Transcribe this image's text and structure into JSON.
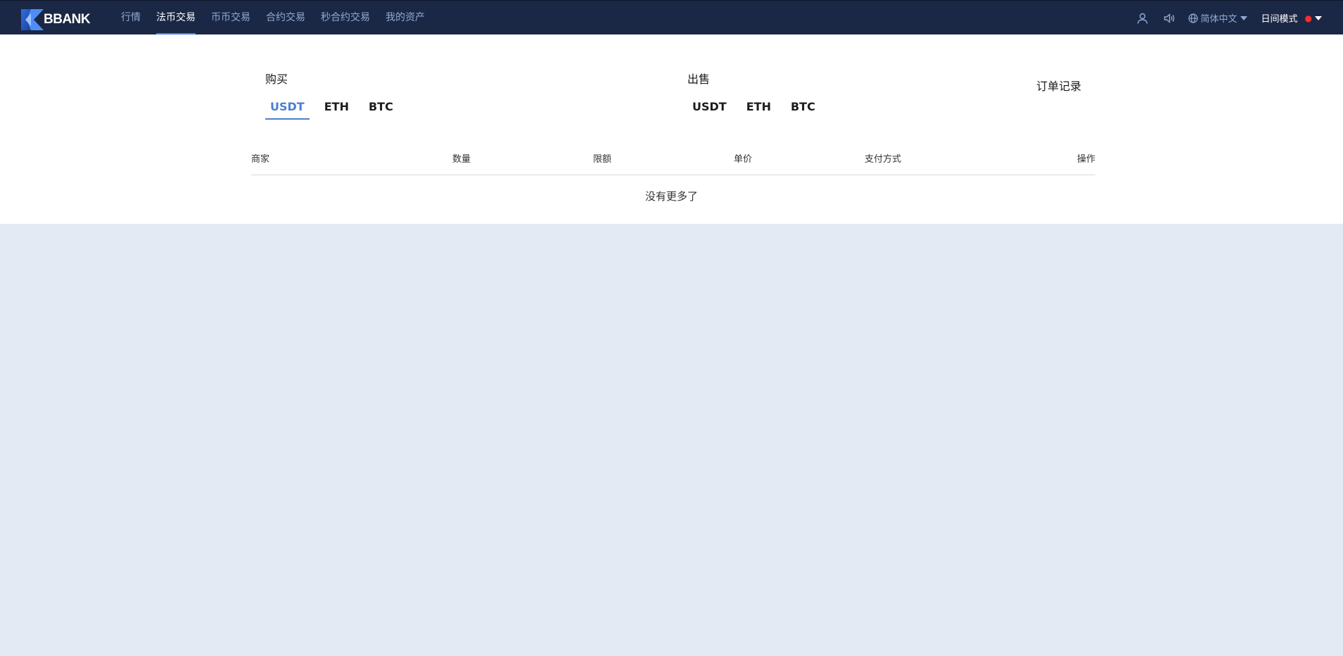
{
  "brand": {
    "name": "BBANK"
  },
  "nav": [
    {
      "label": "行情",
      "active": false
    },
    {
      "label": "法币交易",
      "active": true
    },
    {
      "label": "币币交易",
      "active": false
    },
    {
      "label": "合约交易",
      "active": false
    },
    {
      "label": "秒合约交易",
      "active": false
    },
    {
      "label": "我的资产",
      "active": false
    }
  ],
  "tools": {
    "language": "简体中文",
    "mode": "日间模式",
    "icons": [
      "user-icon",
      "speaker-icon",
      "globe-icon"
    ]
  },
  "buy": {
    "title": "购买",
    "coins": [
      "USDT",
      "ETH",
      "BTC"
    ],
    "active": "USDT"
  },
  "sell": {
    "title": "出售",
    "coins": [
      "USDT",
      "ETH",
      "BTC"
    ]
  },
  "order_record": "订单记录",
  "table": {
    "headers": [
      "商家",
      "数量",
      "限额",
      "单价",
      "支付方式",
      "操作"
    ],
    "empty_text": "没有更多了"
  },
  "colors": {
    "topbar": "#1b2845",
    "accent": "#4a7fd4",
    "page_bg": "#e4eaf4"
  }
}
